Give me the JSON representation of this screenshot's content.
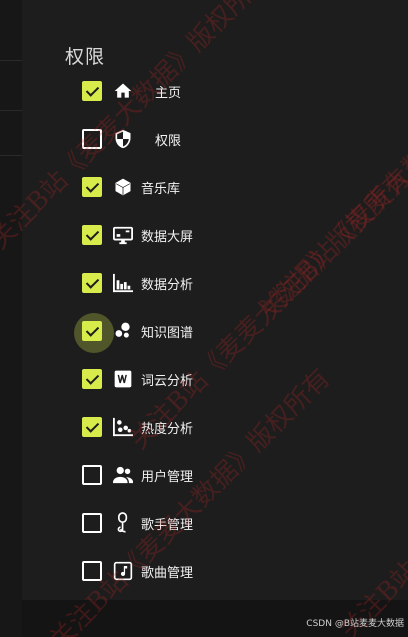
{
  "panel": {
    "title": "权限"
  },
  "items": [
    {
      "label": "主页",
      "checked": true,
      "icon": "home-icon"
    },
    {
      "label": "权限",
      "checked": false,
      "icon": "shield-icon"
    },
    {
      "label": "音乐库",
      "checked": true,
      "icon": "cube-icon"
    },
    {
      "label": "数据大屏",
      "checked": true,
      "icon": "monitor-icon"
    },
    {
      "label": "数据分析",
      "checked": true,
      "icon": "bar-chart-icon"
    },
    {
      "label": "知识图谱",
      "checked": true,
      "icon": "bubble-icon"
    },
    {
      "label": "词云分析",
      "checked": true,
      "icon": "wordcloud-icon"
    },
    {
      "label": "热度分析",
      "checked": true,
      "icon": "scatter-icon"
    },
    {
      "label": "用户管理",
      "checked": false,
      "icon": "users-icon"
    },
    {
      "label": "歌手管理",
      "checked": false,
      "icon": "singer-icon"
    },
    {
      "label": "歌曲管理",
      "checked": false,
      "icon": "music-note-icon"
    }
  ],
  "watermark": {
    "text": "关注B站《麦麦大数据》版权所有"
  },
  "footer": {
    "text": "CSDN @B站麦麦大数据"
  },
  "colors": {
    "accent": "#d7ec4a",
    "panel": "#1d1d1d",
    "watermark": "#be2828"
  }
}
